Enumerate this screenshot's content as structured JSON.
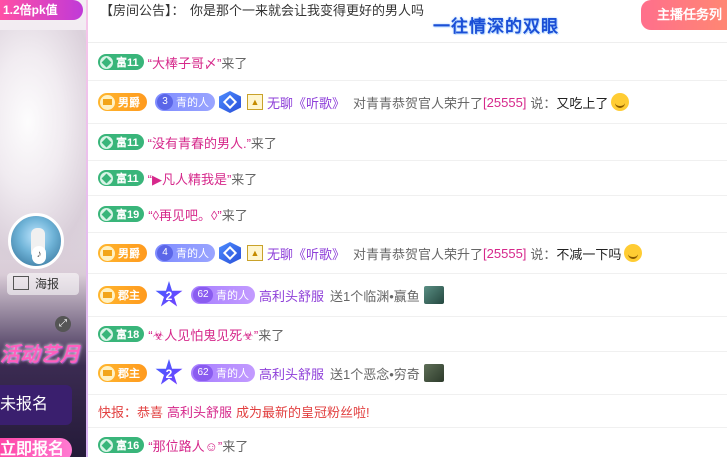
{
  "left": {
    "pk_badge": "1.2倍pk值",
    "haibao": "海报",
    "festival": "活动艺月",
    "register1": "未报名",
    "register2": "立即报名"
  },
  "notice": {
    "label": "【房间公告】：",
    "text": "你是那个一来就会让我变得更好的男人吗",
    "title_art": "一往情深的双眼",
    "task_button": "主播任务列"
  },
  "badges": {
    "fu11": "富11",
    "fu19": "富19",
    "fu18": "富18",
    "fu16": "富16",
    "nanjue": "男爵",
    "junzhu": "郡主",
    "fans_3": "3",
    "fans_4": "4",
    "fans_62": "62",
    "fans_label": "青的人",
    "star_2": "2"
  },
  "messages": [
    {
      "name": "“大棒子哥〆”",
      "action": "来了"
    },
    {
      "name": "无聊《听歌》",
      "mid": "对青青恭贺官人荣升了",
      "num": "[25555]",
      "say": "说：",
      "text": "又吃上了"
    },
    {
      "name": "“没有青春的男人.”",
      "action": "来了"
    },
    {
      "name": "“▶凡人精我是”",
      "action": "来了"
    },
    {
      "name": "“◊再见吧。◊”",
      "action": "来了"
    },
    {
      "name": "无聊《听歌》",
      "mid": "对青青恭贺官人荣升了",
      "num": "[25555]",
      "say": "说：",
      "text": "不减一下吗"
    },
    {
      "name": "高利头舒服",
      "gift": "送1个临渊•赢鱼"
    },
    {
      "name": "“☣人见怕鬼见死☣”",
      "action": "来了"
    },
    {
      "name": "高利头舒服",
      "gift": "送1个恶念•穷奇"
    },
    {
      "prefix": "快报：恭喜",
      "name": "高利头舒服",
      "suffix": "成为最新的皇冠粉丝啦!"
    },
    {
      "name": "“那位路人☺”",
      "action": "来了"
    }
  ]
}
